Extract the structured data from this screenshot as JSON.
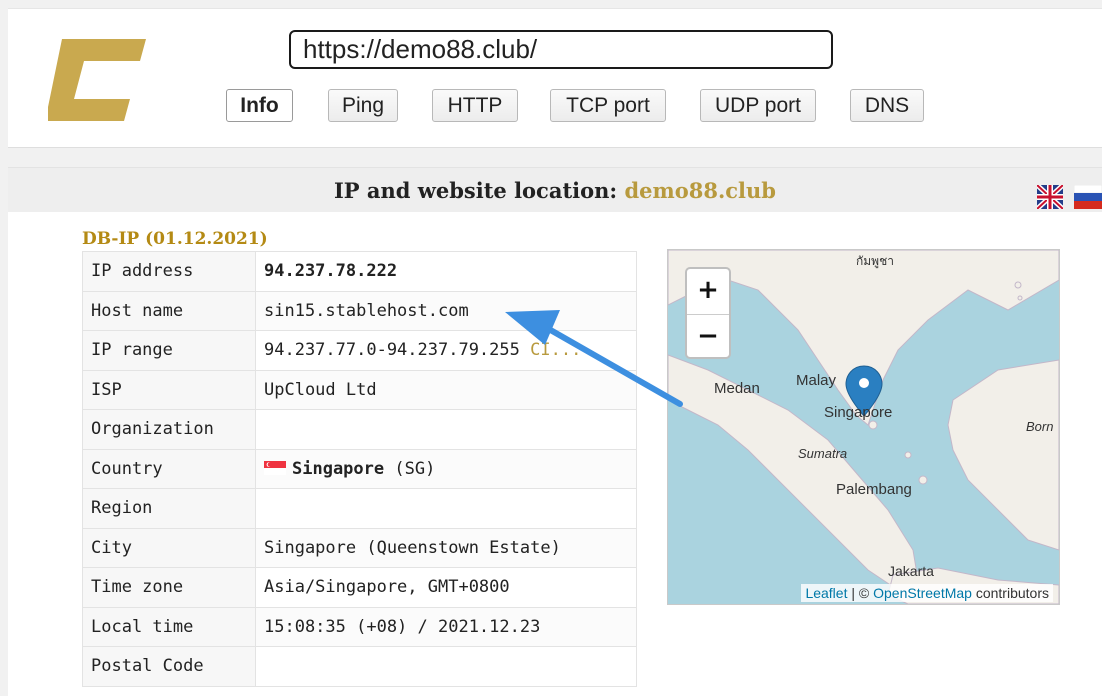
{
  "header": {
    "url_value": "https://demo88.club/",
    "tabs": [
      {
        "label": "Info",
        "active": true
      },
      {
        "label": "Ping"
      },
      {
        "label": "HTTP"
      },
      {
        "label": "TCP port"
      },
      {
        "label": "UDP port"
      },
      {
        "label": "DNS"
      }
    ]
  },
  "panel": {
    "title_prefix": "IP and website location:",
    "title_domain": "demo88.club",
    "languages": [
      "en-flag-icon",
      "ru-flag-icon"
    ]
  },
  "source": "DB-IP (01.12.2021)",
  "rows": [
    {
      "key": "IP address",
      "value": "94.237.78.222"
    },
    {
      "key": "Host name",
      "value": "sin15.stablehost.com"
    },
    {
      "key": "IP range",
      "value": "94.237.77.0-94.237.79.255",
      "link": "CI..."
    },
    {
      "key": "ISP",
      "value": "UpCloud Ltd"
    },
    {
      "key": "Organization",
      "value": ""
    },
    {
      "key": "Country",
      "value": "Singapore",
      "code": "(SG)"
    },
    {
      "key": "Region",
      "value": ""
    },
    {
      "key": "City",
      "value": "Singapore (Queenstown Estate)"
    },
    {
      "key": "Time zone",
      "value": "Asia/Singapore, GMT+0800"
    },
    {
      "key": "Local time",
      "value": "15:08:35 (+08) / 2021.12.23"
    },
    {
      "key": "Postal Code",
      "value": ""
    }
  ],
  "map": {
    "zoom_in": "+",
    "zoom_out": "−",
    "labels": {
      "top_script": "กัมพูชา",
      "medan": "Medan",
      "malaysia": "Malay",
      "singapore": "Singapore",
      "borneo": "Born",
      "sumatra": "Sumatra",
      "palembang": "Palembang",
      "jakarta": "Jakarta"
    },
    "attribution": {
      "leaflet": "Leaflet",
      "sep": " | © ",
      "osm": "OpenStreetMap",
      "tail": " contributors"
    }
  },
  "colors": {
    "accent": "#b89a3e",
    "arrow": "#3d8fe0",
    "marker": "#2a7fc1"
  }
}
